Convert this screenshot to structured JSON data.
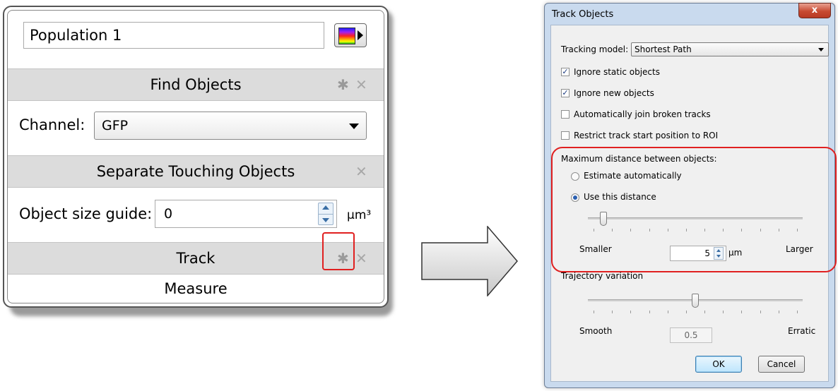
{
  "left_panel": {
    "population_name": "Population 1",
    "find_objects": {
      "title": "Find Objects",
      "channel_label": "Channel:",
      "channel_value": "GFP"
    },
    "separate": {
      "title": "Separate Touching Objects",
      "size_label": "Object size guide:",
      "size_value": "0",
      "unit": "µm³"
    },
    "track": {
      "title": "Track"
    },
    "measure": {
      "title": "Measure"
    }
  },
  "dialog": {
    "title": "Track Objects",
    "close_label": "x",
    "tracking_model_label": "Tracking model:",
    "tracking_model_value": "Shortest Path",
    "checkboxes": [
      {
        "label": "Ignore static objects",
        "checked": true
      },
      {
        "label": "Ignore new objects",
        "checked": true
      },
      {
        "label": "Automatically join broken tracks",
        "checked": false
      },
      {
        "label": "Restrict track start position to ROI",
        "checked": false
      }
    ],
    "max_distance": {
      "heading": "Maximum distance between objects:",
      "radio_auto": "Estimate automatically",
      "radio_manual": "Use this distance",
      "selected": "manual",
      "slider_level": 0.05,
      "min_label": "Smaller",
      "max_label": "Larger",
      "value": "5",
      "unit": "µm"
    },
    "trajectory": {
      "heading": "Trajectory variation",
      "slider_level": 0.5,
      "min_label": "Smooth",
      "max_label": "Erratic",
      "value": "0.5"
    },
    "ok_label": "OK",
    "cancel_label": "Cancel"
  },
  "colors": {
    "highlight": "#e02020",
    "dialog_frame": "#c9daee",
    "section_header": "#dcdcdc"
  }
}
